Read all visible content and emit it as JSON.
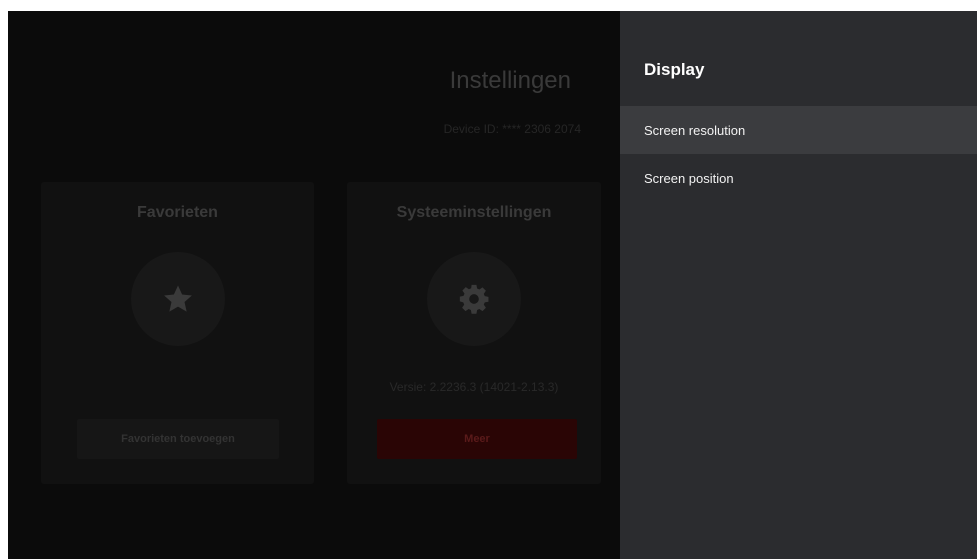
{
  "background": {
    "title": "Instellingen",
    "device_id": "Device ID: **** 2306 2074",
    "favorites_card": {
      "title": "Favorieten",
      "icon": "star-icon",
      "button_label": "Favorieten toevoegen"
    },
    "system_card": {
      "title": "Systeeminstellingen",
      "icon": "gear-icon",
      "version": "Versie: 2.2236.3 (14021-2.13.3)",
      "button_label": "Meer"
    }
  },
  "panel": {
    "title": "Display",
    "items": [
      {
        "label": "Screen resolution",
        "selected": true
      },
      {
        "label": "Screen position",
        "selected": false
      }
    ]
  },
  "colors": {
    "panel_bg": "#2b2c2f",
    "selected_item_bg": "#3b3c3f",
    "accent_button": "#2a0505"
  }
}
